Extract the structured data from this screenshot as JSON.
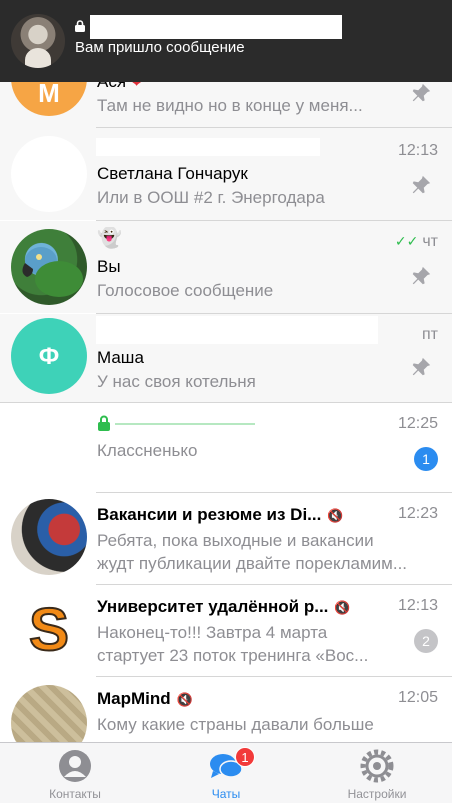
{
  "notification": {
    "lock_icon": "lock-icon",
    "message": "Вам пришло сообщение"
  },
  "chats": [
    {
      "title": "Ася",
      "emoji": "❤",
      "preview": "Там не видно но в конце у меня...",
      "avatar_letter": "М",
      "avatar_color": "#f6a545"
    },
    {
      "title": "Светлана Гончарук",
      "preview": "Или в ООШ #2 г. Энергодара",
      "time": "12:13"
    },
    {
      "top_emoji": "👻",
      "title": "Вы",
      "preview": "Голосовое сообщение",
      "time": "чт",
      "read_checks": "✓✓"
    },
    {
      "title": "Маша",
      "preview": "У нас своя котельня",
      "time": "пт",
      "avatar_letter": "Ф",
      "avatar_color": "#3ed2b8"
    },
    {
      "preview": "Классненько",
      "time": "12:25",
      "badge": "1"
    },
    {
      "title": "Вакансии и резюме из Di...",
      "preview_line1": "Ребята, пока выходные и вакансии",
      "preview_line2": "жудт публикации двайте порекламим...",
      "time": "12:23"
    },
    {
      "title": "Университет удалённой р...",
      "preview_line1": "Наконец-то!!! Завтра 4 марта",
      "preview_line2": "стартует 23 поток тренинга «Вос...",
      "time": "12:13",
      "badge": "2",
      "avatar_letter": "S"
    },
    {
      "title": "MapMind",
      "preview_line1": "Кому какие страны давали больше",
      "time": "12:05"
    }
  ],
  "tabbar": {
    "contacts": "Контакты",
    "chats": "Чаты",
    "chats_badge": "1",
    "settings": "Настройки"
  },
  "colors": {
    "accent": "#2b8cf0",
    "unread_badge": "#2b8cf0",
    "muted_badge": "#c4c4c7",
    "secret_green": "#2ebd4e",
    "tab_badge": "#f23a3a"
  }
}
